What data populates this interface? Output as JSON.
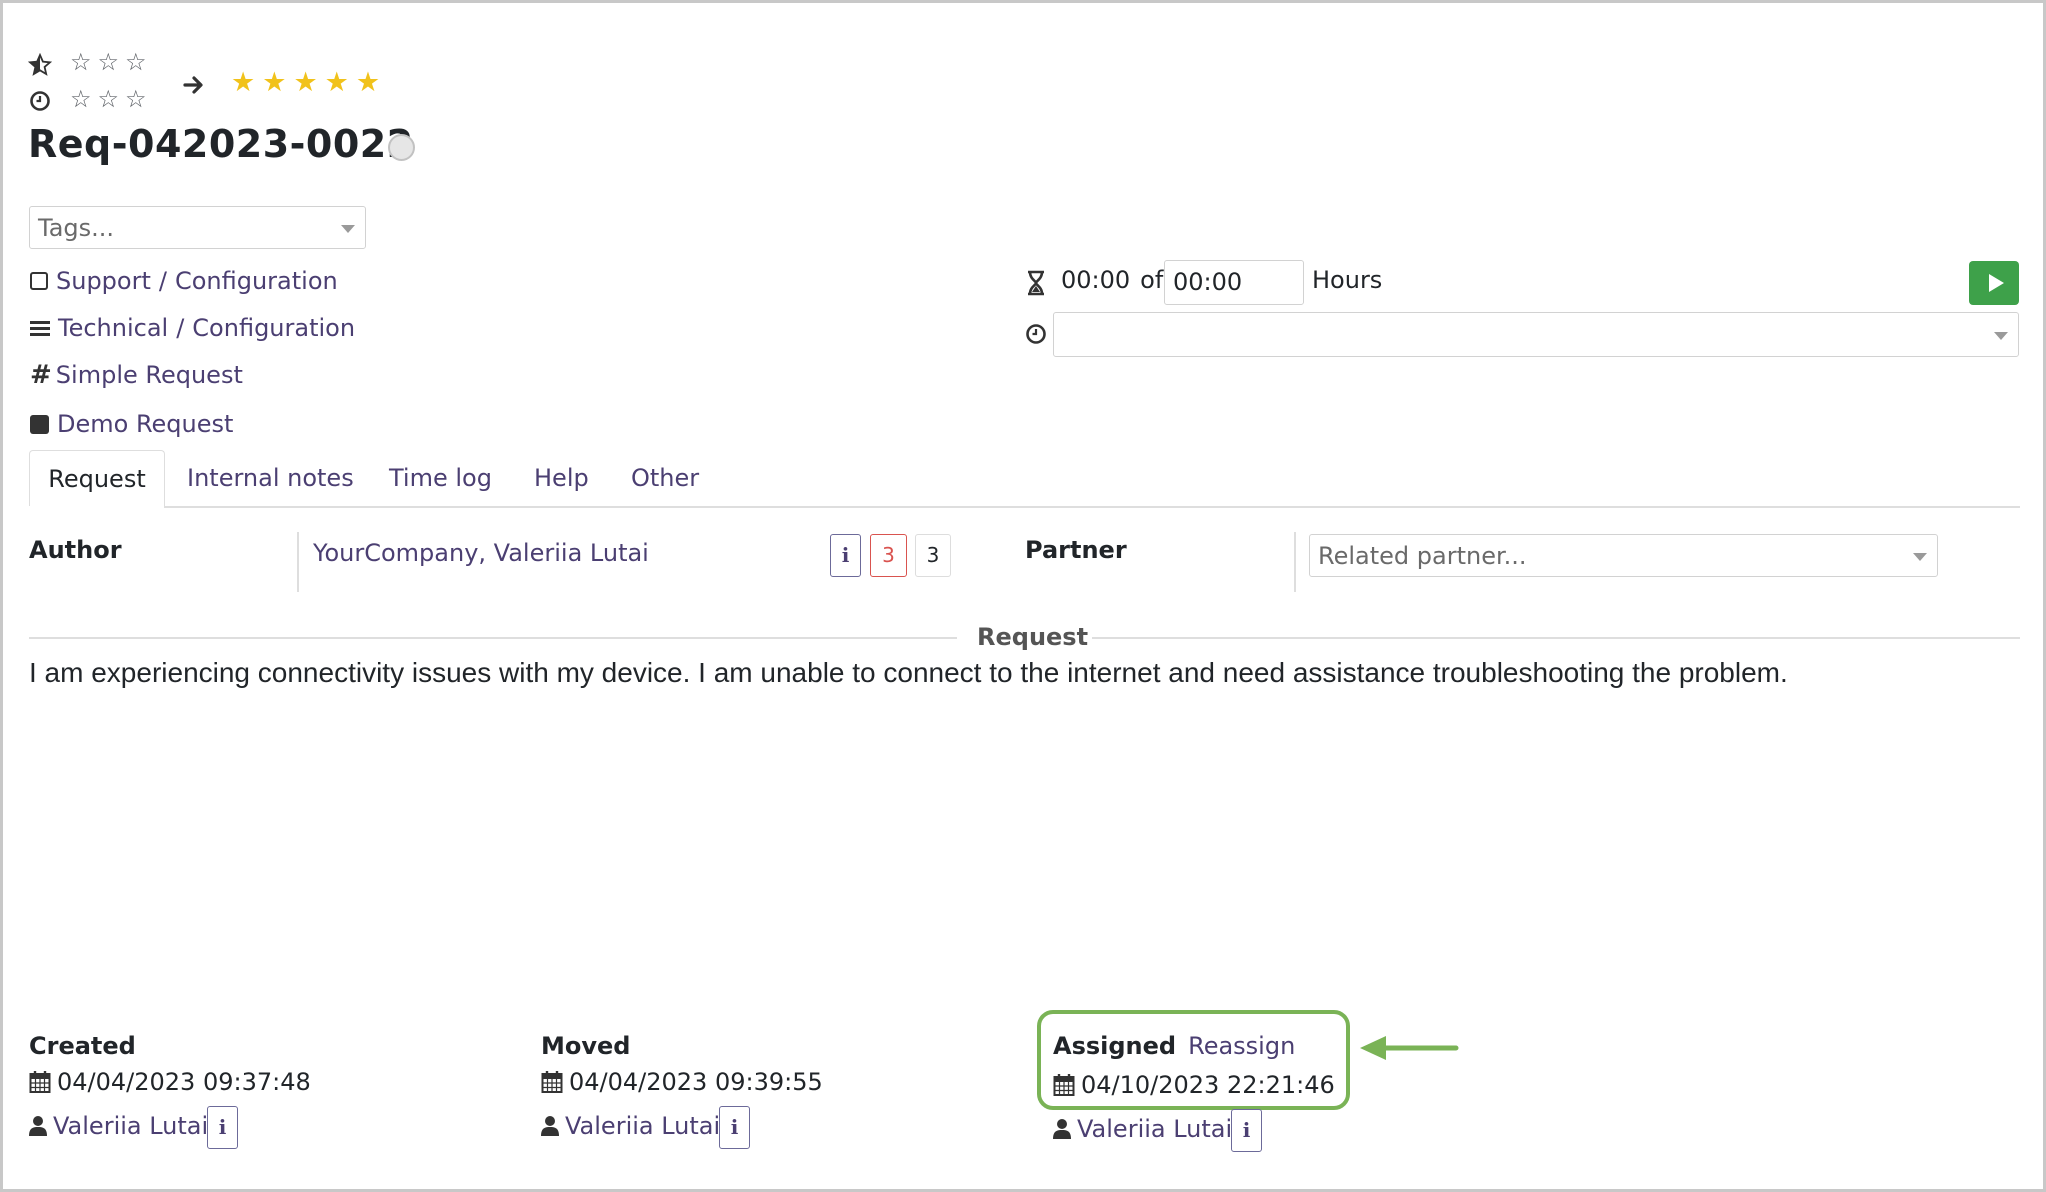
{
  "ratings": {
    "row1_empty_stars": [
      "☆",
      "☆",
      "☆"
    ],
    "row2_empty_stars": [
      "☆",
      "☆",
      "☆"
    ],
    "target_stars": [
      "★",
      "★",
      "★",
      "★",
      "★"
    ]
  },
  "request": {
    "title": "Req-042023-0022",
    "tags_placeholder": "Tags...",
    "service": "Support",
    "service_sub": "Configuration",
    "category": "Technical",
    "category_sub": "Configuration",
    "type": "Simple Request",
    "channel": "Demo Request"
  },
  "timer": {
    "spent": "00:00",
    "of_label": "of",
    "planned": "00:00",
    "unit": "Hours"
  },
  "tabs": [
    {
      "label": "Request"
    },
    {
      "label": "Internal notes"
    },
    {
      "label": "Time log"
    },
    {
      "label": "Help"
    },
    {
      "label": "Other"
    }
  ],
  "author": {
    "label": "Author",
    "value": "YourCompany, Valeriia Lutai",
    "info": "i",
    "badge_red": "3",
    "badge_plain": "3"
  },
  "partner": {
    "label": "Partner",
    "placeholder": "Related partner..."
  },
  "body": {
    "section_title": "Request",
    "text": "I am experiencing connectivity issues with my device. I am unable to connect to the internet and need assistance troubleshooting the problem."
  },
  "created": {
    "label": "Created",
    "date": "04/04/2023 09:37:48",
    "user": "Valeriia Lutai",
    "info": "i"
  },
  "moved": {
    "label": "Moved",
    "date": "04/04/2023 09:39:55",
    "user": "Valeriia Lutai",
    "info": "i"
  },
  "assigned": {
    "label": "Assigned",
    "action": "Reassign",
    "date": "04/10/2023 22:21:46",
    "user": "Valeriia Lutai",
    "info": "i"
  },
  "colors": {
    "accent": "#4b3f72",
    "play_button": "#3ea14a",
    "highlight": "#7ab356",
    "star_gold": "#f1c21b",
    "badge_red": "#d9534f"
  },
  "icons": [
    "half-star-icon",
    "clock-icon",
    "arrow-right-icon",
    "square-outline-icon",
    "bars-icon",
    "hashtag-icon",
    "square-filled-icon",
    "hourglass-icon",
    "play-icon",
    "calendar-icon",
    "user-icon",
    "info-icon",
    "status-circle-icon"
  ]
}
